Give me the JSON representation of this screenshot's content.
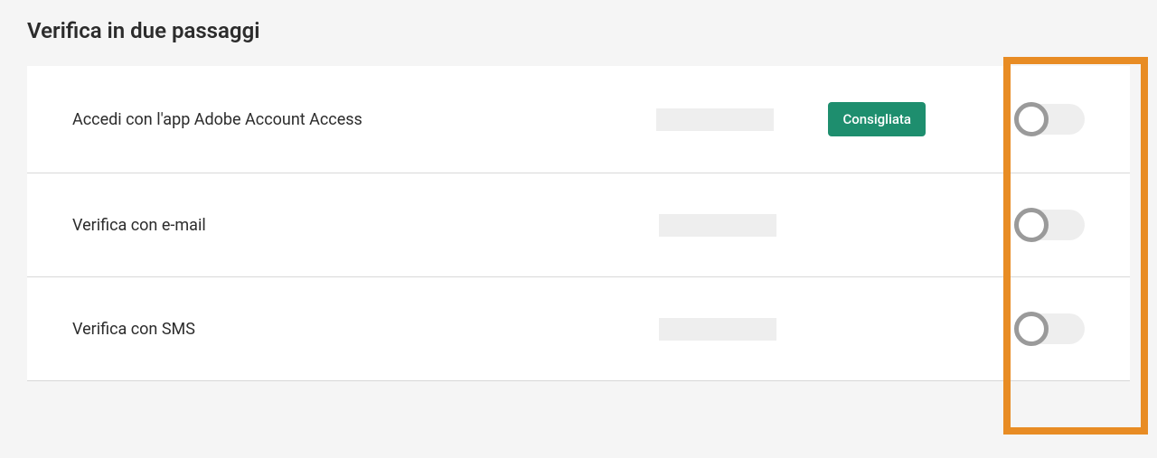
{
  "section": {
    "title": "Verifica in due passaggi"
  },
  "settings": [
    {
      "label": "Accedi con l'app Adobe Account Access",
      "badge": "Consigliata",
      "hasBadge": true,
      "toggleState": "off"
    },
    {
      "label": "Verifica con e-mail",
      "hasBadge": false,
      "toggleState": "off"
    },
    {
      "label": "Verifica con SMS",
      "hasBadge": false,
      "toggleState": "off"
    }
  ]
}
